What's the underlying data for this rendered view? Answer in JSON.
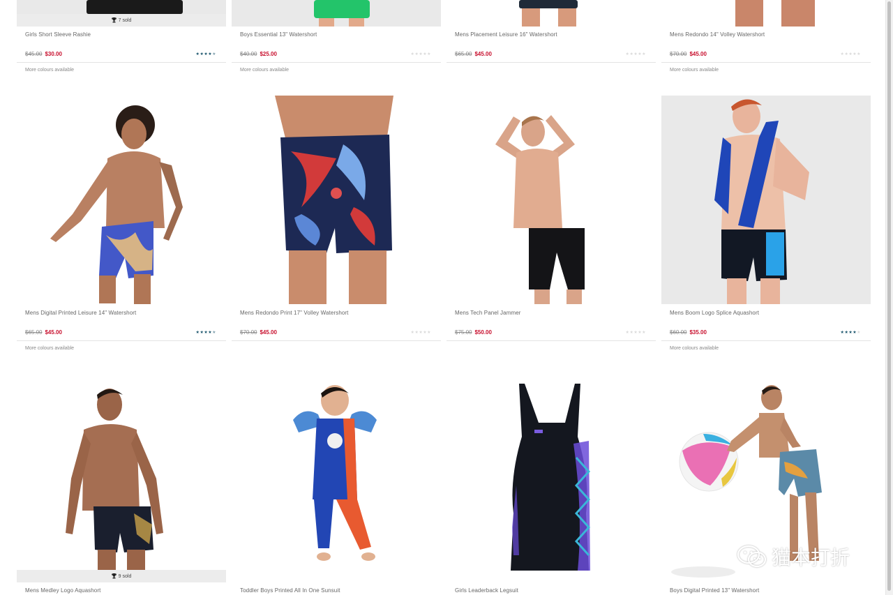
{
  "products": [
    {
      "name": "Girls Short Sleeve Rashie",
      "old_price": "$45.00",
      "new_price": "$30.00",
      "rating": 4.5,
      "sold_badge": "7 sold",
      "more_colours": "More colours available"
    },
    {
      "name": "Boys Essential 13\" Watershort",
      "old_price": "$40.00",
      "new_price": "$25.00",
      "rating": 0,
      "more_colours": "More colours available"
    },
    {
      "name": "Mens Placement Leisure 16\" Watershort",
      "old_price": "$65.00",
      "new_price": "$45.00",
      "rating": 0,
      "more_colours": ""
    },
    {
      "name": "Mens Redondo 14\" Volley Watershort",
      "old_price": "$70.00",
      "new_price": "$45.00",
      "rating": 0,
      "more_colours": "More colours available"
    },
    {
      "name": "Mens Digital Printed Leisure 14\" Watershort",
      "old_price": "$65.00",
      "new_price": "$45.00",
      "rating": 4.5,
      "more_colours": "More colours available"
    },
    {
      "name": "Mens Redondo Print 17\" Volley Watershort",
      "old_price": "$70.00",
      "new_price": "$45.00",
      "rating": 0,
      "more_colours": ""
    },
    {
      "name": "Mens Tech Panel Jammer",
      "old_price": "$75.00",
      "new_price": "$50.00",
      "rating": 0,
      "more_colours": ""
    },
    {
      "name": "Mens Boom Logo Splice Aquashort",
      "old_price": "$60.00",
      "new_price": "$35.00",
      "rating": 4,
      "more_colours": "More colours available"
    },
    {
      "name": "Mens Medley Logo Aquashort",
      "sold_badge": "9 sold"
    },
    {
      "name": "Toddler Boys Printed All In One Sunsuit"
    },
    {
      "name": "Girls Leaderback Legsuit"
    },
    {
      "name": "Boys Digital Printed 13\" Watershort"
    }
  ],
  "watermark": {
    "text": "猫本打折"
  },
  "colors": {
    "sale_red": "#c8102e",
    "star_on": "#17526a",
    "star_off": "#dadada"
  }
}
